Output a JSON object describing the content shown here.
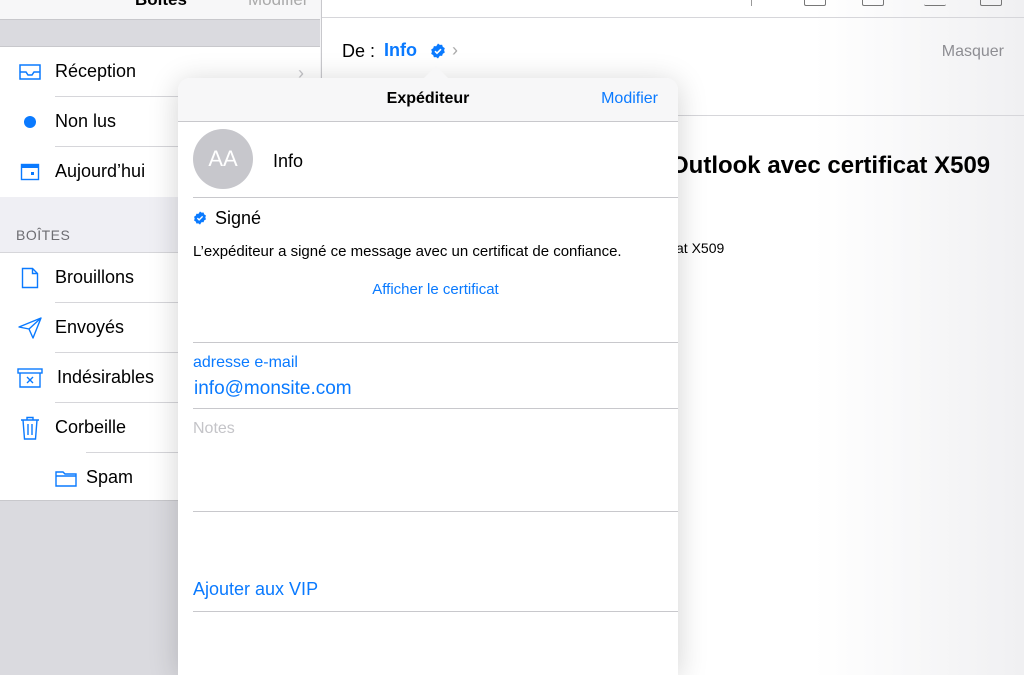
{
  "sidebar": {
    "top_title": "Boîtes",
    "top_edit": "Modifier",
    "items": [
      {
        "label": "Réception",
        "icon": "inbox-icon"
      },
      {
        "label": "Non lus",
        "icon": "unread-dot-icon"
      },
      {
        "label": "Aujourd’hui",
        "icon": "calendar-icon"
      }
    ],
    "section_title": "BOÎTES",
    "mailboxes": [
      {
        "label": "Brouillons",
        "icon": "document-icon"
      },
      {
        "label": "Envoyés",
        "icon": "paper-plane-icon"
      },
      {
        "label": "Indésirables",
        "icon": "junk-box-icon"
      },
      {
        "label": "Corbeille",
        "icon": "trash-icon"
      },
      {
        "label": "Spam",
        "icon": "folder-icon"
      }
    ]
  },
  "message": {
    "from_label": "De :",
    "from_name": "Info",
    "hide_label": "Masquer",
    "subject_fragment": "Outlook avec certificat X509",
    "body_fragment": "at X509"
  },
  "popover": {
    "title": "Expéditeur",
    "edit_label": "Modifier",
    "avatar_initials": "AA",
    "contact_name": "Info",
    "signed_label": "Signé",
    "signed_description": "L’expéditeur a signé ce message avec un certificat de confiance.",
    "show_certificate": "Afficher le certificat",
    "email_label": "adresse e-mail",
    "email_value": "info@monsite.com",
    "notes_placeholder": "Notes",
    "add_vip": "Ajouter aux VIP"
  },
  "colors": {
    "accent": "#0a7aff",
    "sidebar_bg": "#dadadf",
    "avatar_bg": "#c7c7cc"
  }
}
